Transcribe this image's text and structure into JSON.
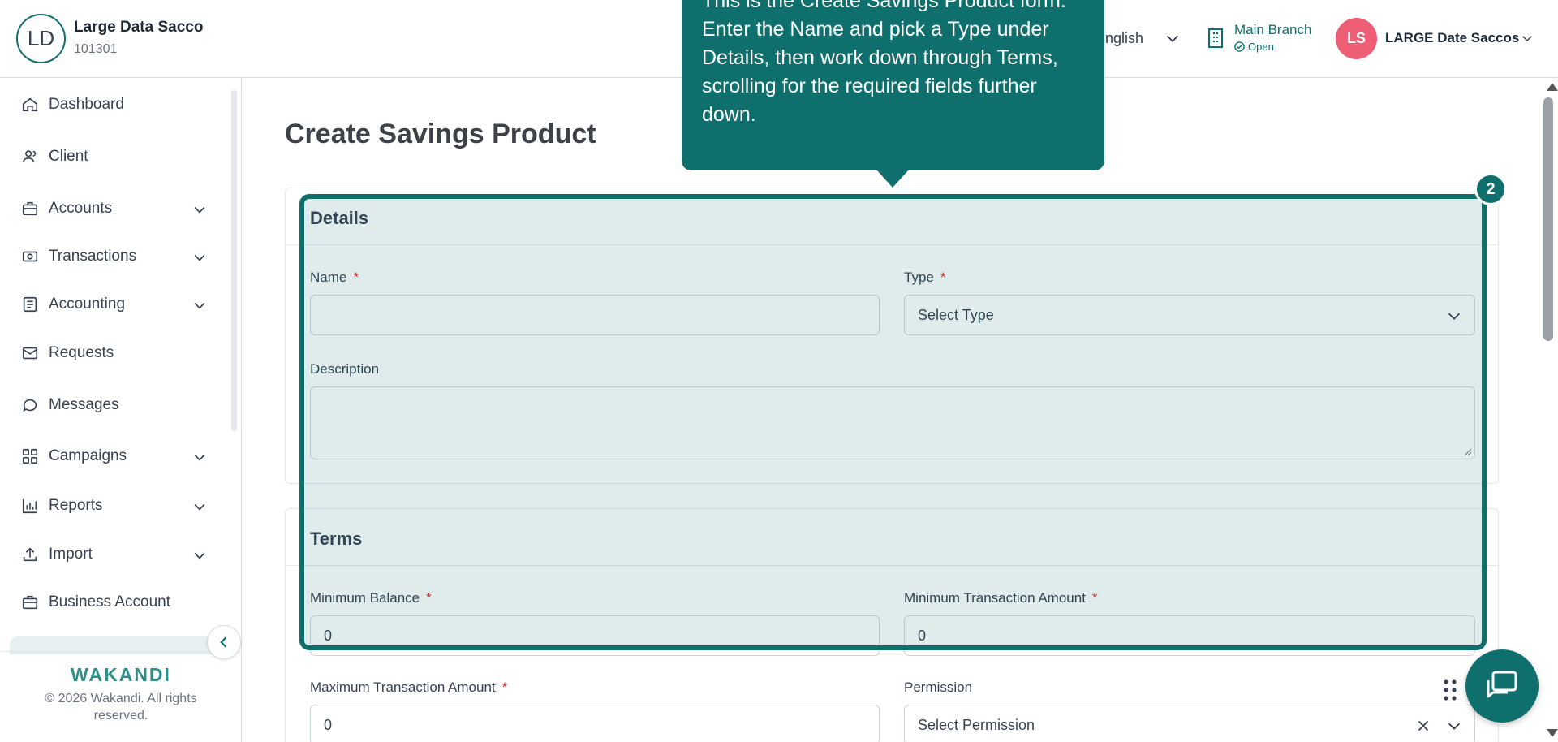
{
  "header": {
    "org_initials": "LD",
    "org_name": "Large Data Sacco",
    "org_code": "101301",
    "language": "nglish",
    "branch_name": "Main Branch",
    "branch_status": "Open",
    "user_initials": "LS",
    "user_name": "LARGE Date Saccos"
  },
  "sidebar": {
    "items": [
      {
        "label": "Dashboard",
        "icon": "home-icon",
        "has_chevron": false
      },
      {
        "label": "Client",
        "icon": "users-icon",
        "has_chevron": false
      },
      {
        "label": "Accounts",
        "icon": "briefcase-icon",
        "has_chevron": true
      },
      {
        "label": "Transactions",
        "icon": "money-icon",
        "has_chevron": true
      },
      {
        "label": "Accounting",
        "icon": "ledger-icon",
        "has_chevron": true
      },
      {
        "label": "Requests",
        "icon": "mail-icon",
        "has_chevron": false
      },
      {
        "label": "Messages",
        "icon": "chat-icon",
        "has_chevron": false
      },
      {
        "label": "Campaigns",
        "icon": "grid-icon",
        "has_chevron": true
      },
      {
        "label": "Reports",
        "icon": "bar-chart-icon",
        "has_chevron": true
      },
      {
        "label": "Import",
        "icon": "upload-icon",
        "has_chevron": true
      },
      {
        "label": "Business Account",
        "icon": "briefcase-icon",
        "has_chevron": false
      }
    ],
    "brand": "WAKANDI",
    "copyright": "© 2026 Wakandi. All rights reserved."
  },
  "main": {
    "title": "Create Savings Product",
    "details": {
      "heading": "Details",
      "name_label": "Name",
      "name_value": "",
      "type_label": "Type",
      "type_placeholder": "Select Type",
      "description_label": "Description"
    },
    "terms": {
      "heading": "Terms",
      "min_balance_label": "Minimum Balance",
      "min_balance_value": "0",
      "min_txn_label": "Minimum Transaction Amount",
      "min_txn_value": "0",
      "max_txn_label": "Maximum Transaction Amount",
      "max_txn_value": "0",
      "permission_label": "Permission",
      "permission_placeholder": "Select Permission"
    },
    "required_mark": "*"
  },
  "tour": {
    "step": "2",
    "text": "This is the Create Savings Product form. Enter the Name and pick a Type under Details, then work down through Terms, scrolling for the required fields further down."
  },
  "colors": {
    "primary": "#0f6f6c",
    "avatar_pink": "#ee5f76",
    "required_red": "#dc2626"
  }
}
